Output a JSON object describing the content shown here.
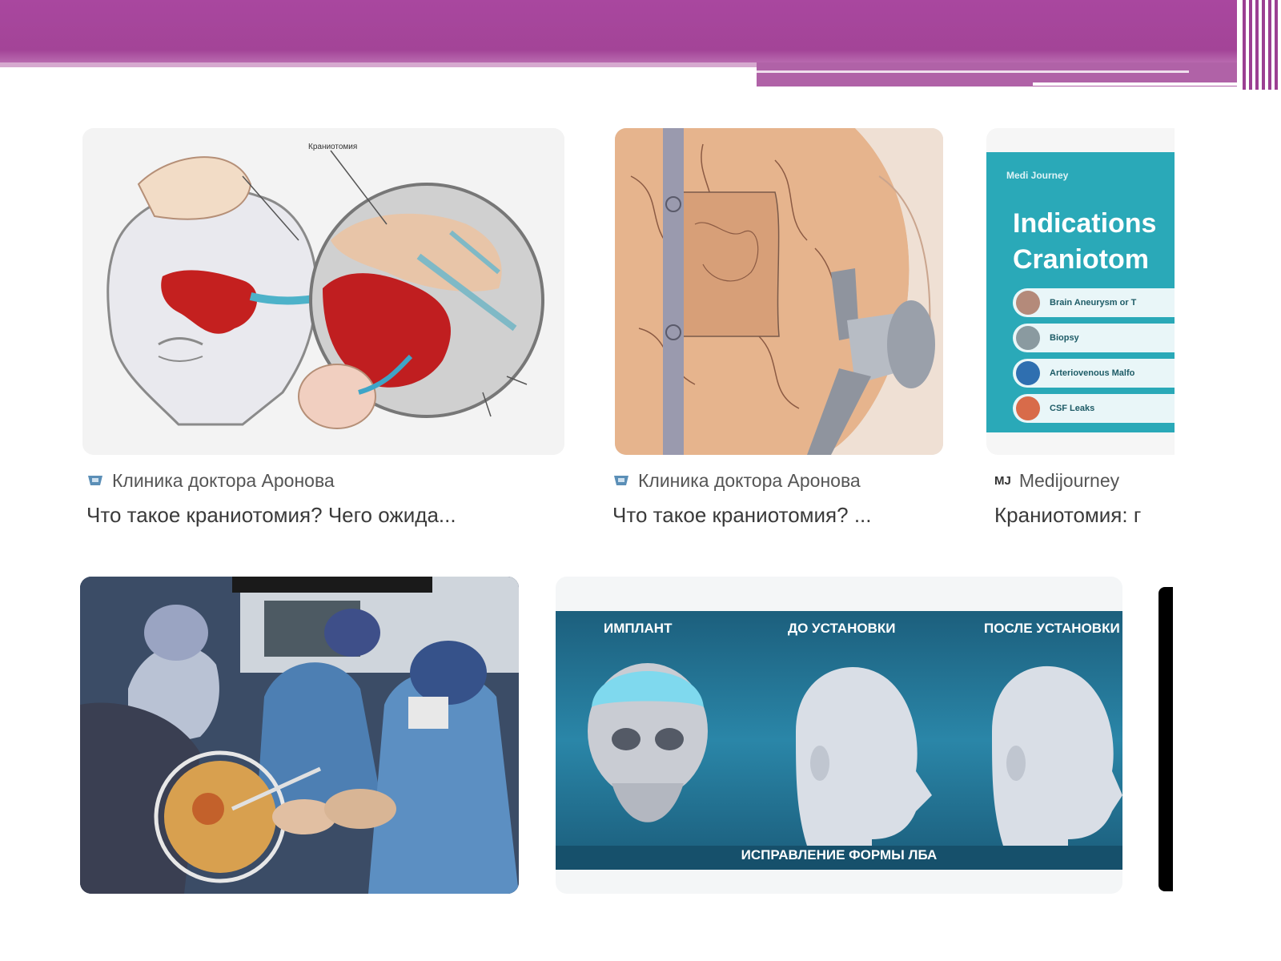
{
  "results": [
    {
      "source": "Клиника доктора Аронова",
      "title": "Что такое краниотомия? Чего ожида...",
      "diagram_label": "Краниотомия",
      "favicon": "clinic-icon"
    },
    {
      "source": "Клиника доктора Аронова",
      "title": "Что такое краниотомия? ...",
      "favicon": "clinic-icon"
    },
    {
      "source": "Medijourney",
      "title": "Краниотомия: г",
      "favicon": "mj-logo-icon",
      "favicon_text": "MJ",
      "thumb": {
        "brand": "Medi Journey",
        "heading1": "Indications",
        "heading2": "Craniotom",
        "items": [
          "Brain Aneurysm or T",
          "Biopsy",
          "Arteriovenous Malfo",
          "CSF Leaks"
        ]
      }
    }
  ],
  "images": [
    {
      "kind": "surgery-photo"
    },
    {
      "kind": "implant-infographic",
      "labels": {
        "implant": "ИМПЛАНТ",
        "before": "ДО УСТАНОВКИ",
        "after": "ПОСЛЕ УСТАНОВКИ",
        "caption": "ИСПРАВЛЕНИЕ ФОРМЫ ЛБА"
      }
    }
  ],
  "colors": {
    "header": "#a9479f",
    "teal": "#2aa9b8",
    "infographic": "#1f6a86"
  }
}
